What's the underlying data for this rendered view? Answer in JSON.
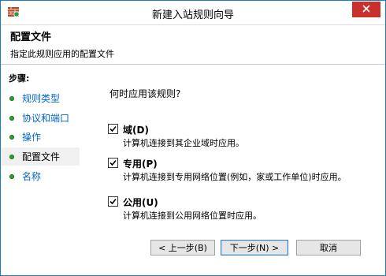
{
  "window": {
    "title": "新建入站规则向导"
  },
  "header": {
    "title": "配置文件",
    "subtitle": "指定此规则应用的配置文件"
  },
  "sidebar": {
    "steps_label": "步骤:",
    "items": [
      {
        "label": "规则类型",
        "current": false
      },
      {
        "label": "协议和端口",
        "current": false
      },
      {
        "label": "操作",
        "current": false
      },
      {
        "label": "配置文件",
        "current": true
      },
      {
        "label": "名称",
        "current": false
      }
    ]
  },
  "main": {
    "question": "何时应用该规则?",
    "options": [
      {
        "label": "域(D)",
        "description": "计算机连接到其企业域时应用。",
        "checked": true
      },
      {
        "label": "专用(P)",
        "description": "计算机连接到专用网络位置(例如，家或工作单位)时应用。",
        "checked": true
      },
      {
        "label": "公用(U)",
        "description": "计算机连接到公用网络位置时应用。",
        "checked": true
      }
    ]
  },
  "buttons": {
    "back": "< 上一步(B)",
    "next": "下一步(N) >",
    "cancel": "取消"
  },
  "colors": {
    "link": "#0066cc",
    "bullet": "#2e9e2e",
    "close": "#c7302b",
    "border": "#1979ca"
  }
}
